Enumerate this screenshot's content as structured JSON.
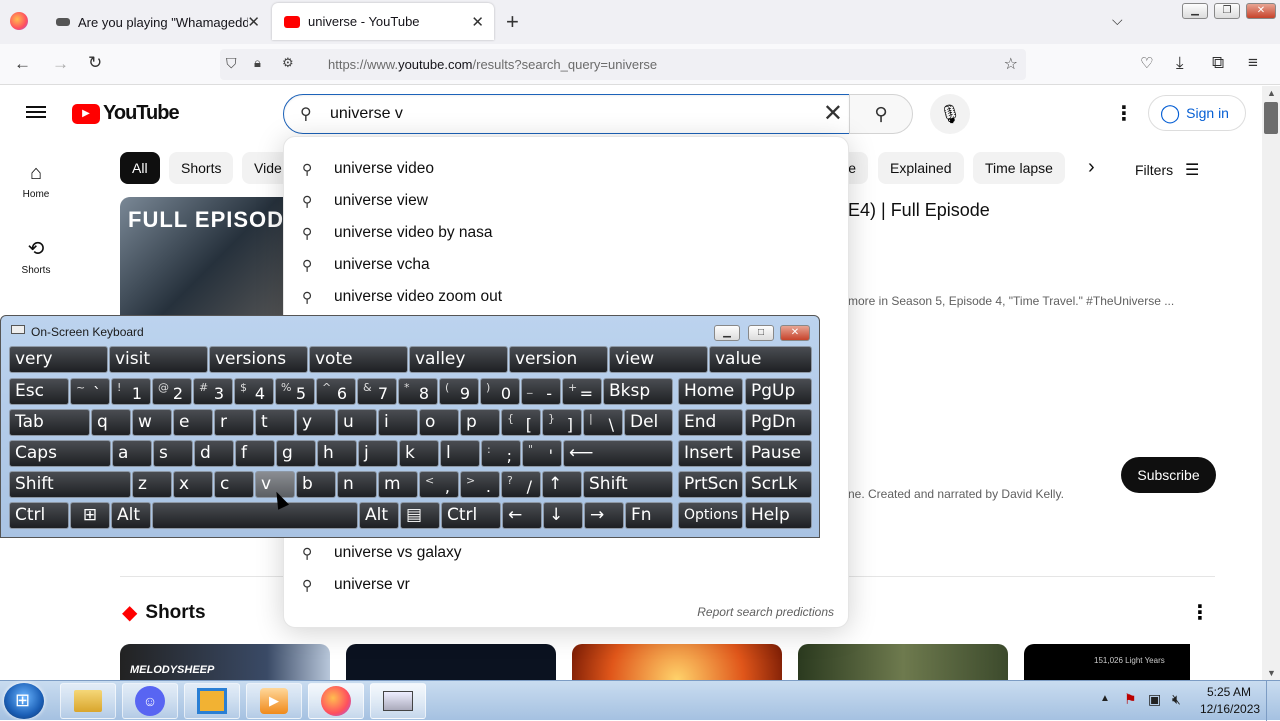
{
  "browser": {
    "tabs": [
      {
        "label": "Are you playing \"Whamageddo",
        "close": "✕"
      },
      {
        "label": "universe - YouTube",
        "close": "✕"
      }
    ],
    "new_tab": "+",
    "url_prefix": "https://www.",
    "url_host": "youtube.com",
    "url_path": "/results?search_query=universe"
  },
  "youtube": {
    "logo_text": "YouTube",
    "search_value": "universe v",
    "sign_in": "Sign in",
    "sidebar": [
      {
        "label": "Home"
      },
      {
        "label": "Shorts"
      }
    ],
    "chips": [
      "All",
      "Shorts",
      "Vide",
      "e",
      "Explained",
      "Time lapse"
    ],
    "filters": "Filters",
    "video_title_fragment": "E4) | Full Episode",
    "video_desc_fragment": "more in Season 5, Episode 4, \"Time Travel.\" #TheUniverse ...",
    "thumb_text": "FULL EPISODE",
    "channel_desc_fragment": "ne. Created and narrated by David Kelly.",
    "subscribe": "Subscribe",
    "shorts_heading": "Shorts",
    "shorts_thumb_label": "MELODYSHEEP",
    "shorts_thumb_label2": "151,026 Light Years",
    "suggestions": [
      "universe video",
      "universe view",
      "universe video by nasa",
      "universe vcha",
      "universe video zoom out",
      "universe vs galaxy",
      "universe vr"
    ],
    "report": "Report search predictions"
  },
  "osk": {
    "title": "On-Screen Keyboard",
    "predictions": [
      "very",
      "visit",
      "versions",
      "vote",
      "valley",
      "version",
      "view",
      "value"
    ],
    "row1": [
      {
        "main": "Esc"
      },
      {
        "top": "~",
        "bot": "`"
      },
      {
        "top": "!",
        "bot": "1"
      },
      {
        "top": "@",
        "bot": "2"
      },
      {
        "top": "#",
        "bot": "3"
      },
      {
        "top": "$",
        "bot": "4"
      },
      {
        "top": "%",
        "bot": "5"
      },
      {
        "top": "^",
        "bot": "6"
      },
      {
        "top": "&",
        "bot": "7"
      },
      {
        "top": "*",
        "bot": "8"
      },
      {
        "top": "(",
        "bot": "9"
      },
      {
        "top": ")",
        "bot": "0"
      },
      {
        "top": "_",
        "bot": "-"
      },
      {
        "top": "+",
        "bot": "="
      },
      {
        "main": "Bksp"
      },
      {
        "main": "Home"
      },
      {
        "main": "PgUp"
      }
    ],
    "row2": [
      "Tab",
      "q",
      "w",
      "e",
      "r",
      "t",
      "y",
      "u",
      "i",
      "o",
      "p",
      "[",
      "]",
      "\\",
      "Del",
      "End",
      "PgDn"
    ],
    "row2_top": [
      "",
      "",
      "",
      "",
      "",
      "",
      "",
      "",
      "",
      "",
      "",
      "{",
      "}",
      "|",
      "",
      "",
      ""
    ],
    "row3": [
      "Caps",
      "a",
      "s",
      "d",
      "f",
      "g",
      "h",
      "j",
      "k",
      "l",
      ";",
      "'",
      "⟵",
      "Insert",
      "Pause"
    ],
    "row3_top": [
      "",
      "",
      "",
      "",
      "",
      "",
      "",
      "",
      "",
      "",
      ":",
      "\"",
      "",
      "",
      ""
    ],
    "row4": [
      "Shift",
      "z",
      "x",
      "c",
      "v",
      "b",
      "n",
      "m",
      ",",
      ".",
      "/",
      "↑",
      "Shift",
      "PrtScn",
      "ScrLk"
    ],
    "row4_top": [
      "",
      "",
      "",
      "",
      "",
      "",
      "",
      "",
      "<",
      ">",
      "?",
      "",
      "",
      "",
      ""
    ],
    "row5": [
      "Ctrl",
      "⊞",
      "Alt",
      "",
      "Alt",
      "▤",
      "Ctrl",
      "←",
      "↓",
      "→",
      "Fn",
      "Options",
      "Help"
    ]
  },
  "taskbar": {
    "time": "5:25 AM",
    "date": "12/16/2023"
  },
  "colors": {
    "yt_red": "#ff0000",
    "accent_blue": "#065fd4",
    "osk_bg": "#b5cdeb"
  }
}
